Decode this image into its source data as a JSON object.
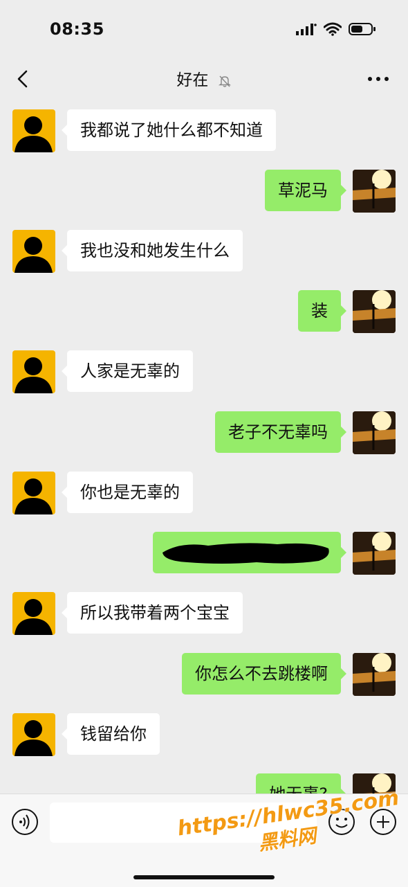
{
  "status_bar": {
    "time": "08:35"
  },
  "header": {
    "title": "好在",
    "muted": true
  },
  "messages": [
    {
      "side": "left",
      "text": "我都说了她什么都不知道"
    },
    {
      "side": "right",
      "text": "草泥马"
    },
    {
      "side": "left",
      "text": "我也没和她发生什么"
    },
    {
      "side": "right",
      "text": "装"
    },
    {
      "side": "left",
      "text": "人家是无辜的"
    },
    {
      "side": "right",
      "text": "老子不无辜吗"
    },
    {
      "side": "left",
      "text": "你也是无辜的"
    },
    {
      "side": "right",
      "text": "",
      "redacted": true
    },
    {
      "side": "left",
      "text": "所以我带着两个宝宝"
    },
    {
      "side": "right",
      "text": "你怎么不去跳楼啊"
    },
    {
      "side": "left",
      "text": "钱留给你"
    },
    {
      "side": "right",
      "text": "她无辜?"
    }
  ],
  "colors": {
    "bubble_right": "#95ec69",
    "bubble_left": "#ffffff",
    "background": "#ededed",
    "avatar_left_bg": "#f5b400"
  },
  "icons": {
    "back": "chevron-left-icon",
    "mute": "bell-off-icon",
    "more": "more-dots-icon",
    "voice": "voice-icon",
    "emoji": "emoji-icon",
    "plus": "plus-icon"
  },
  "watermark": {
    "url": "https://hlwc35.com",
    "label": "黑料网"
  }
}
